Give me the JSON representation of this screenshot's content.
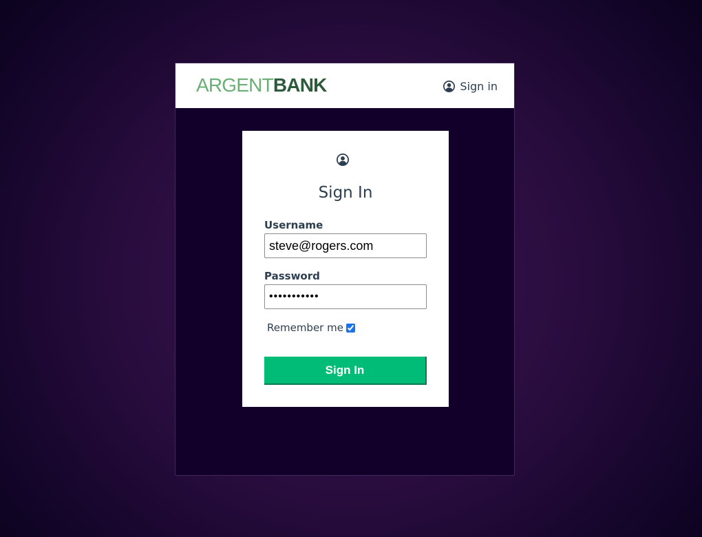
{
  "navbar": {
    "logo_part1": "ARGENT",
    "logo_part2": "BANK",
    "signin_label": "Sign in",
    "user_icon": "user-circle-icon"
  },
  "signin_form": {
    "icon": "user-circle-icon",
    "title": "Sign In",
    "username_label": "Username",
    "username_value": "steve@rogers.com",
    "password_label": "Password",
    "password_value": "•••••••••••",
    "remember_label": "Remember me",
    "remember_checked": true,
    "submit_label": "Sign In"
  },
  "colors": {
    "logo_light": "#6aaf75",
    "logo_dark": "#2c5a3a",
    "button": "#00bc77",
    "text": "#2c3e50",
    "window_bg": "#12002b"
  }
}
